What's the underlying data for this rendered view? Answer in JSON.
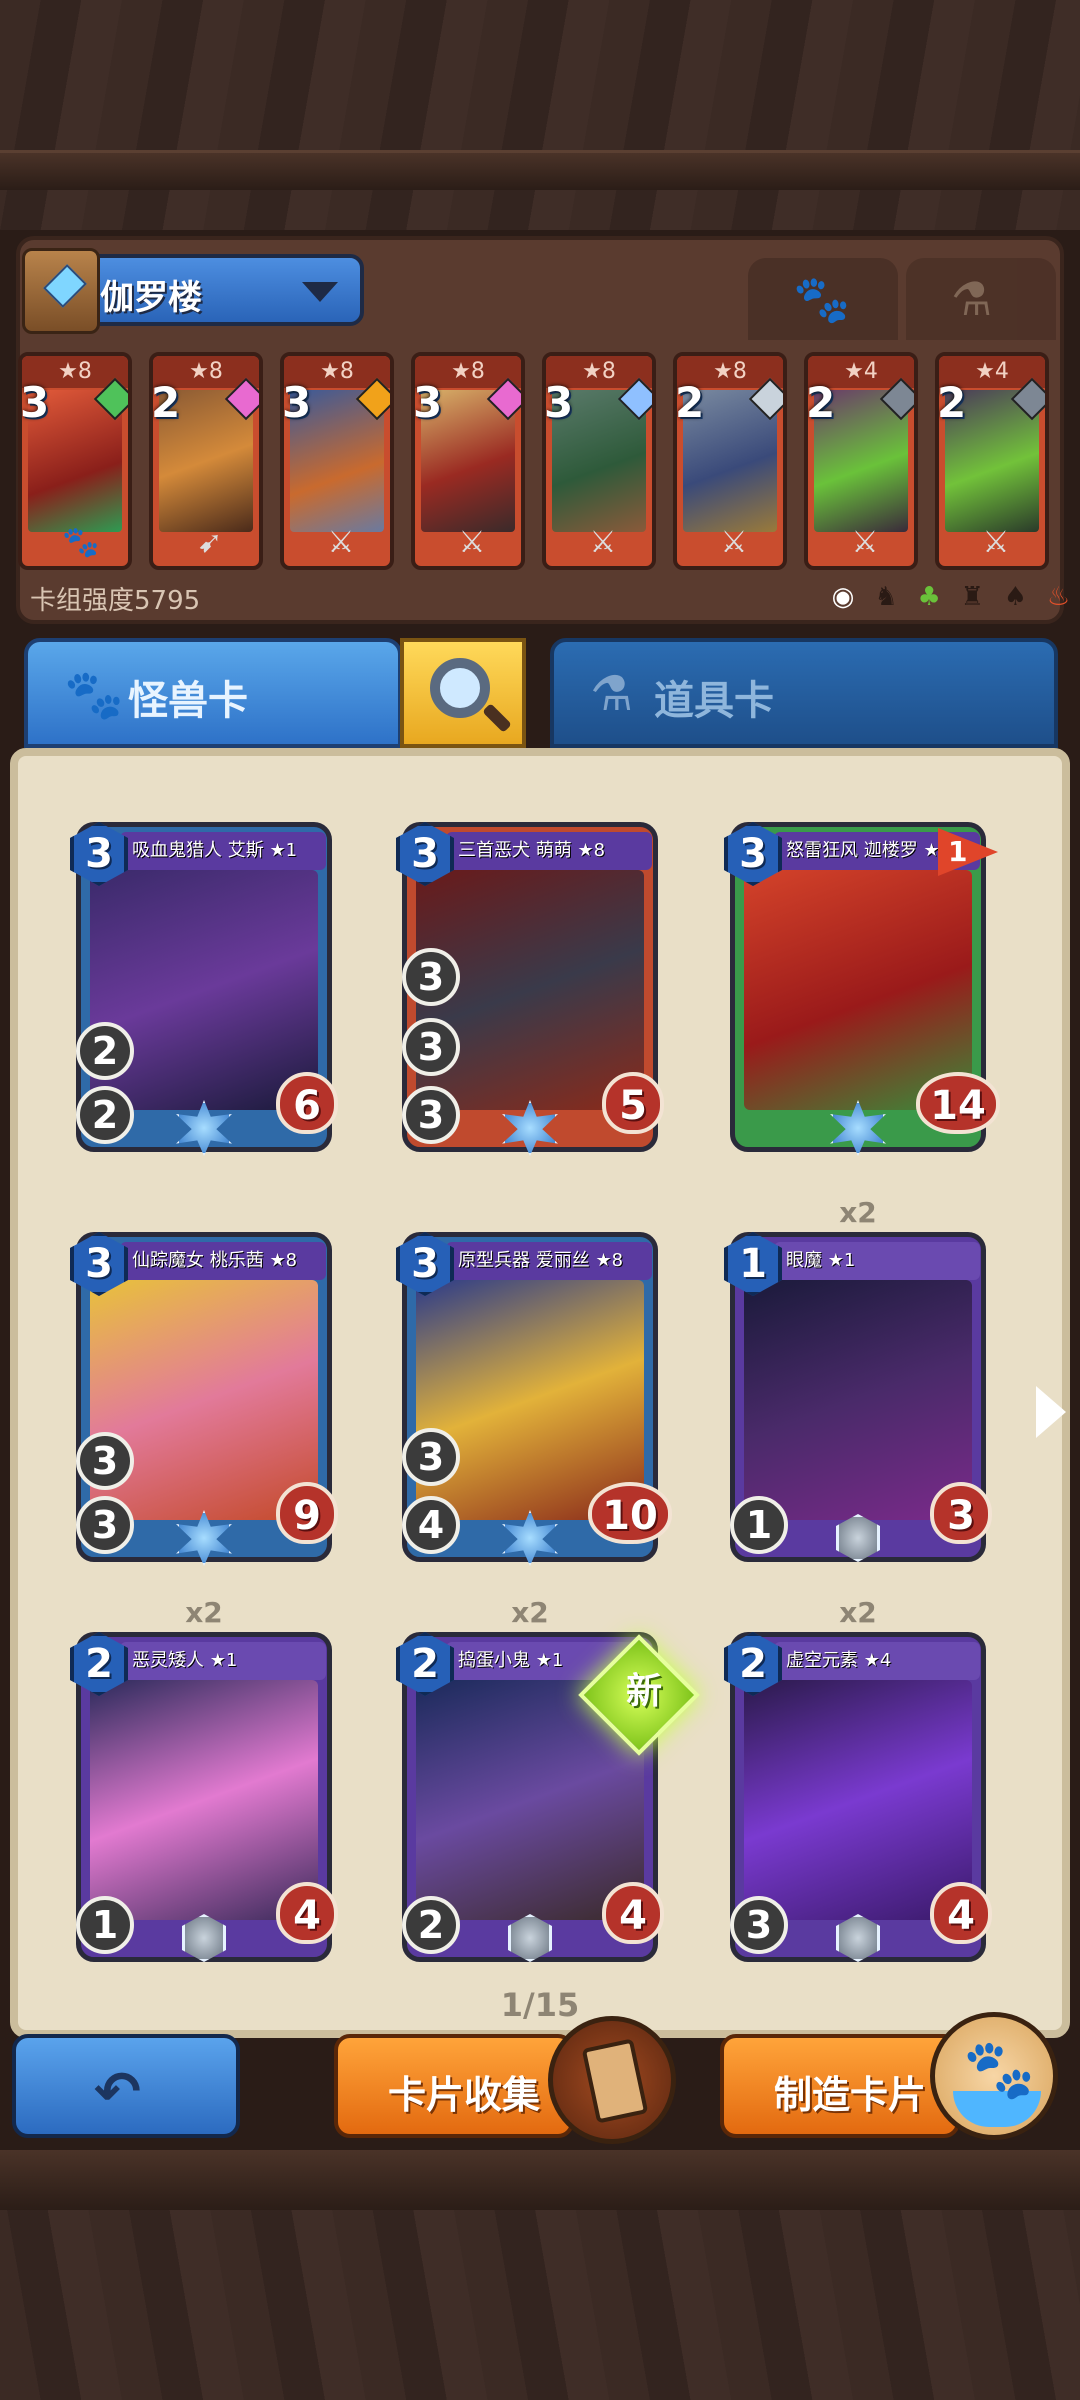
{
  "deck": {
    "name": "伽罗楼",
    "power_label": "卡组强度5795",
    "tabs": [
      "paw-icon",
      "potion-icon"
    ],
    "mini_cards": [
      {
        "stars": "★8",
        "cost": "3",
        "gem_color": "#4fc25a",
        "weapon": "paw"
      },
      {
        "stars": "★8",
        "cost": "2",
        "gem_color": "#e86ad0",
        "weapon": "bow"
      },
      {
        "stars": "★8",
        "cost": "3",
        "gem_color": "#f1a21a",
        "weapon": "sword"
      },
      {
        "stars": "★8",
        "cost": "3",
        "gem_color": "#e86ad0",
        "weapon": "sword"
      },
      {
        "stars": "★8",
        "cost": "3",
        "gem_color": "#8fc0ff",
        "weapon": "sword"
      },
      {
        "stars": "★8",
        "cost": "2",
        "gem_color": "#c9d3dc",
        "weapon": "sword"
      },
      {
        "stars": "★4",
        "cost": "2",
        "gem_color": "#7d8794",
        "weapon": "sword"
      },
      {
        "stars": "★4",
        "cost": "2",
        "gem_color": "#7d8794",
        "weapon": "sword"
      }
    ],
    "filter_icons": [
      "circle-icon",
      "beast-icon",
      "plant-icon",
      "dragon-icon",
      "bird-icon",
      "fire-icon"
    ]
  },
  "categories": {
    "monster_label": "怪兽卡",
    "item_label": "道具卡"
  },
  "cards": [
    {
      "name": "吸血鬼猎人 艾斯 ★1",
      "cost": "3",
      "atk": "2",
      "def": "2",
      "hp": "6",
      "count": ""
    },
    {
      "name": "三首恶犬 萌萌 ★8",
      "cost": "3",
      "atk": "3",
      "def": "3",
      "hp": "5",
      "count": ""
    },
    {
      "name": "怒雷狂风 迦楼罗 ★8",
      "cost": "3",
      "atk": "",
      "def": "",
      "hp": "14",
      "count": "",
      "flag": "1"
    },
    {
      "name": "仙踪魔女 桃乐茜 ★8",
      "cost": "3",
      "atk": "3",
      "def": "3",
      "hp": "9",
      "count": ""
    },
    {
      "name": "原型兵器 爱丽丝 ★8",
      "cost": "3",
      "atk": "3",
      "def": "4",
      "hp": "10",
      "count": ""
    },
    {
      "name": "眼魔 ★1",
      "cost": "1",
      "atk": "",
      "def": "1",
      "hp": "3",
      "count": "x2"
    },
    {
      "name": "恶灵矮人 ★1",
      "cost": "2",
      "atk": "",
      "def": "1",
      "hp": "4",
      "count": "x2"
    },
    {
      "name": "捣蛋小鬼 ★1",
      "cost": "2",
      "atk": "",
      "def": "2",
      "hp": "4",
      "count": "x2"
    },
    {
      "name": "虚空元素 ★4",
      "cost": "2",
      "atk": "",
      "def": "3",
      "hp": "4",
      "count": "x2"
    }
  ],
  "new_badge": "新",
  "page_indicator": "1/15",
  "buttons": {
    "collect_label": "卡片收集",
    "craft_label": "制造卡片"
  }
}
